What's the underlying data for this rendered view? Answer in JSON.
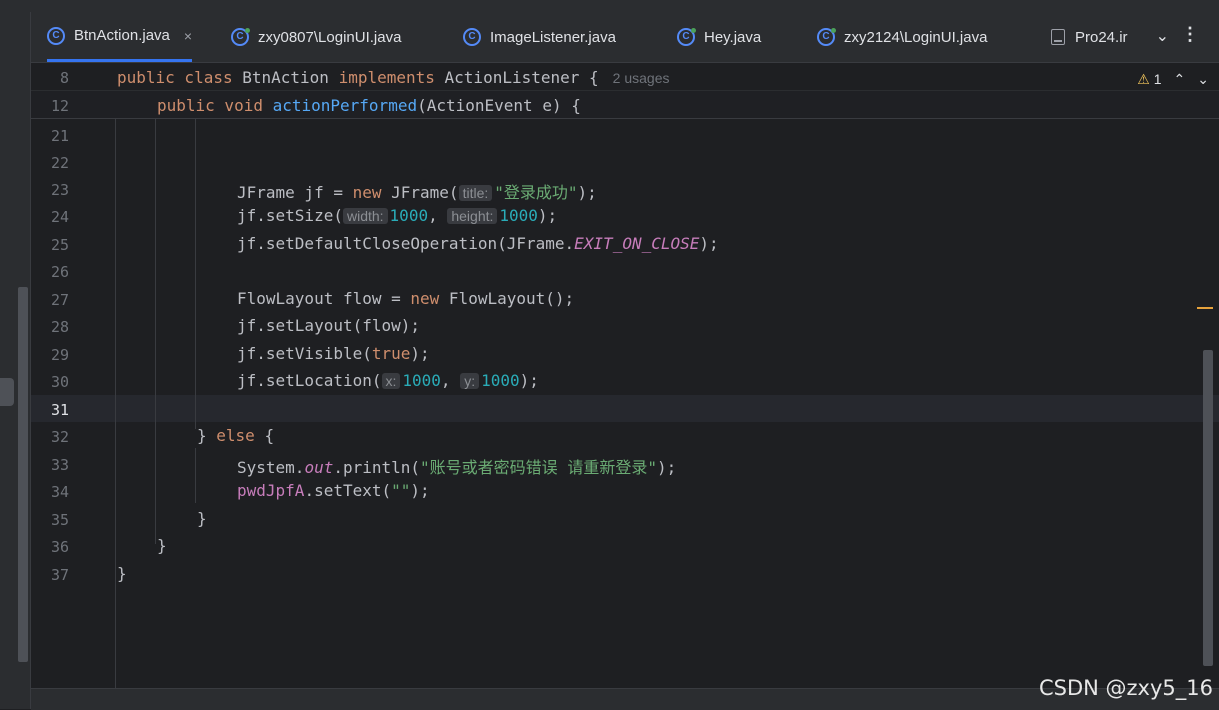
{
  "tabs": [
    {
      "label": "BtnAction.java",
      "icon": "class-icon",
      "active": true
    },
    {
      "label": "zxy0807\\LoginUI.java",
      "icon": "class-run-icon"
    },
    {
      "label": "ImageListener.java",
      "icon": "class-icon"
    },
    {
      "label": "Hey.java",
      "icon": "class-run-icon"
    },
    {
      "label": "zxy2124\\LoginUI.java",
      "icon": "class-run-icon"
    },
    {
      "label": "Pro24.ir",
      "icon": "file-icon"
    }
  ],
  "tab_close_glyph": "×",
  "sticky": {
    "line1": {
      "num": "8",
      "kw1": "public class ",
      "name": "BtnAction ",
      "kw2": "implements ",
      "iface": "ActionListener {",
      "usages": "2 usages"
    },
    "line2": {
      "num": "12",
      "kw1": "public void ",
      "fn": "actionPerformed",
      "rest": "(ActionEvent e) {"
    }
  },
  "inspection": {
    "count": "1"
  },
  "lines": {
    "l21": "21",
    "l22": "22",
    "l23": "23",
    "l24": "24",
    "l25": "25",
    "l26": "26",
    "l27": "27",
    "l28": "28",
    "l29": "29",
    "l30": "30",
    "l31": "31",
    "l32": "32",
    "l33": "33",
    "l34": "34",
    "l35": "35",
    "l36": "36",
    "l37": "37"
  },
  "code": {
    "c23a": "JFrame jf = ",
    "c23kw": "new ",
    "c23b": "JFrame(",
    "c23hint": "title:",
    "c23str": "\"登录成功\"",
    "c23end": ");",
    "c24a": "jf.setSize(",
    "c24hint1": "width:",
    "c24num1": "1000",
    "c24comma": ", ",
    "c24hint2": "height:",
    "c24num2": "1000",
    "c24end": ");",
    "c25a": "jf.setDefaultCloseOperation(JFrame.",
    "c25const": "EXIT_ON_CLOSE",
    "c25end": ");",
    "c27a": "FlowLayout flow = ",
    "c27kw": "new ",
    "c27b": "FlowLayout();",
    "c28": "jf.setLayout(flow);",
    "c29a": "jf.setVisible(",
    "c29kw": "true",
    "c29end": ");",
    "c30a": "jf.setLocation(",
    "c30hint1": "x:",
    "c30num1": "1000",
    "c30comma": ", ",
    "c30hint2": "y:",
    "c30num2": "1000",
    "c30end": ");",
    "c32a": "} ",
    "c32kw": "else ",
    "c32b": "{",
    "c33a": "System.",
    "c33field": "out",
    "c33b": ".println(",
    "c33str": "\"账号或者密码错误 请重新登录\"",
    "c33end": ");",
    "c34field": "pwdJpfA",
    "c34b": ".setText(",
    "c34str": "\"\"",
    "c34end": ");",
    "c35": "}",
    "c36": "}",
    "c37": "}"
  },
  "watermark": "CSDN @zxy5_16"
}
